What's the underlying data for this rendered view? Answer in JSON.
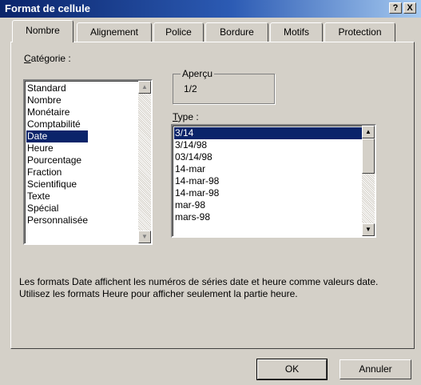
{
  "window": {
    "title": "Format de cellule",
    "help_label": "?",
    "close_label": "X"
  },
  "tabs": [
    {
      "label": "Nombre",
      "active": true
    },
    {
      "label": "Alignement",
      "active": false
    },
    {
      "label": "Police",
      "active": false
    },
    {
      "label": "Bordure",
      "active": false
    },
    {
      "label": "Motifs",
      "active": false
    },
    {
      "label": "Protection",
      "active": false
    }
  ],
  "category": {
    "label_first": "C",
    "label_rest": "atégorie :",
    "items": [
      "Standard",
      "Nombre",
      "Monétaire",
      "Comptabilité",
      "Date",
      "Heure",
      "Pourcentage",
      "Fraction",
      "Scientifique",
      "Texte",
      "Spécial",
      "Personnalisée"
    ],
    "selected": "Date"
  },
  "preview": {
    "label": "Aperçu",
    "value": "1/2"
  },
  "type": {
    "label_first": "T",
    "label_rest": "ype :",
    "items": [
      "3/14",
      "3/14/98",
      "03/14/98",
      "14-mar",
      "14-mar-98",
      "14-mar-98",
      "mar-98",
      "mars-98"
    ],
    "selected": "3/14"
  },
  "description": "Les formats Date affichent les numéros de séries date et heure comme valeurs date. Utilisez les formats Heure pour afficher seulement la partie heure.",
  "buttons": {
    "ok": "OK",
    "cancel": "Annuler"
  },
  "colors": {
    "titlebar_start": "#0a246a",
    "titlebar_end": "#a6caf0",
    "selection": "#0a246a",
    "face": "#d4d0c8"
  },
  "icons": {
    "scroll_up": "triangle-up",
    "scroll_down": "triangle-down"
  }
}
